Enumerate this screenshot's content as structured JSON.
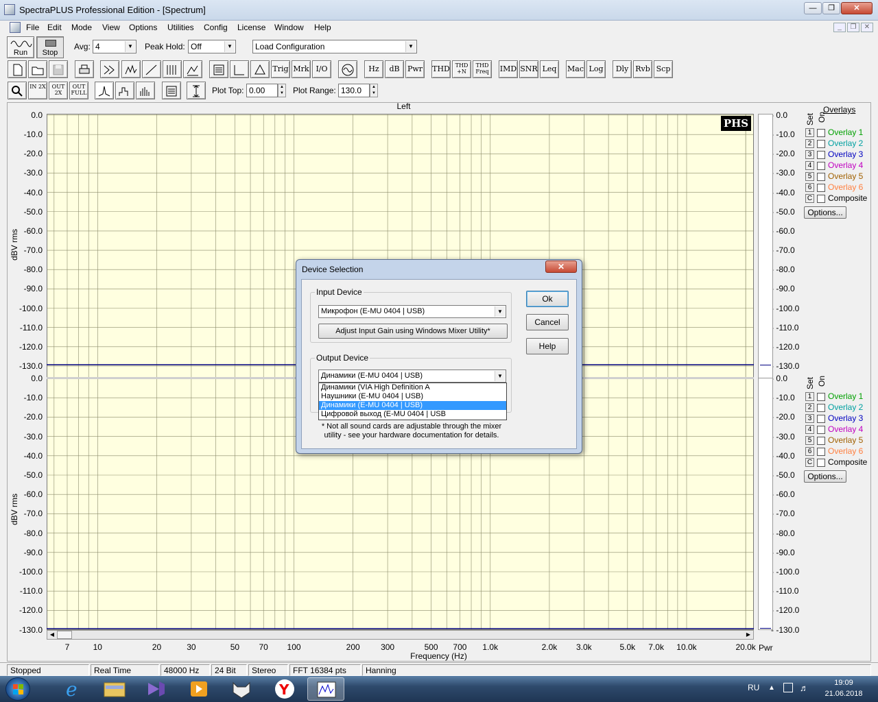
{
  "window": {
    "title": "SpectraPLUS Professional Edition - [Spectrum]"
  },
  "menu": [
    "File",
    "Edit",
    "Mode",
    "View",
    "Options",
    "Utilities",
    "Config",
    "License",
    "Window",
    "Help"
  ],
  "toolbar1": {
    "run": "Run",
    "stop": "Stop",
    "avg_label": "Avg:",
    "avg_value": "4",
    "peak_label": "Peak Hold:",
    "peak_value": "Off",
    "load_config": "Load Configuration"
  },
  "toolbar2": {
    "trig": "Trig",
    "mrk": "Mrk",
    "io": "I/O",
    "hz": "Hz",
    "db": "dB",
    "pwr": "Pwr",
    "thd": "THD",
    "thdn": "THD +N",
    "thdfreq": "THD Freq",
    "imd": "IMD",
    "snr": "SNR",
    "leq": "Leq",
    "mac": "Mac",
    "log": "Log",
    "dly": "Dly",
    "rvb": "Rvb",
    "scp": "Scp"
  },
  "toolbar3": {
    "in2x": "IN 2X",
    "out2x": "OUT 2X",
    "outfull": "OUT FULL",
    "plot_top_label": "Plot Top:",
    "plot_top_value": "0.00",
    "plot_range_label": "Plot Range:",
    "plot_range_value": "130.0"
  },
  "plot": {
    "channel": "Left",
    "logo": "PHS",
    "ylabel": "dBV rms",
    "xlabel": "Frequency (Hz)",
    "y_ticks": [
      "0.0",
      "-10.0",
      "-20.0",
      "-30.0",
      "-40.0",
      "-50.0",
      "-60.0",
      "-70.0",
      "-80.0",
      "-90.0",
      "-100.0",
      "-110.0",
      "-120.0",
      "-130.0"
    ],
    "x_ticks": [
      "7",
      "10",
      "20",
      "30",
      "50",
      "70",
      "100",
      "200",
      "300",
      "500",
      "700",
      "1.0k",
      "2.0k",
      "3.0k",
      "5.0k",
      "7.0k",
      "10.0k",
      "20.0k"
    ],
    "pwr_label": "Pwr",
    "bg_color": "#ffffe0",
    "grid_color": "#8a8a6a",
    "trace_color": "#000080"
  },
  "overlays": {
    "title": "Overlays",
    "set_label": "Set",
    "on_label": "On",
    "items": [
      {
        "num": "1",
        "label": "Overlay 1",
        "color": "#00a000"
      },
      {
        "num": "2",
        "label": "Overlay 2",
        "color": "#00a0a0"
      },
      {
        "num": "3",
        "label": "Overlay 3",
        "color": "#0000c0"
      },
      {
        "num": "4",
        "label": "Overlay 4",
        "color": "#c000c0"
      },
      {
        "num": "5",
        "label": "Overlay 5",
        "color": "#a06000"
      },
      {
        "num": "6",
        "label": "Overlay 6",
        "color": "#ff8040"
      },
      {
        "num": "C",
        "label": "Composite",
        "color": "#000000"
      }
    ],
    "options_button": "Options..."
  },
  "dialog": {
    "title": "Device Selection",
    "input_group": "Input Device",
    "input_value": "Микрофон (E-MU 0404 | USB)",
    "adjust_button": "Adjust Input Gain using Windows Mixer Utility*",
    "output_group": "Output Device",
    "output_value": "Динамики (E-MU 0404 | USB)",
    "output_options": [
      "Динамики (VIA High Definition A",
      "Наушники (E-MU 0404 | USB)",
      "Динамики (E-MU 0404 | USB)",
      "Цифровой выход (E-MU 0404 | USB"
    ],
    "selected_index": 2,
    "note_line1": "* Not all sound cards are adjustable through the mixer",
    "note_line2": "utility - see your hardware documentation for details.",
    "ok": "Ok",
    "cancel": "Cancel",
    "help": "Help"
  },
  "statusbar": [
    "Stopped",
    "Real Time",
    "48000 Hz",
    "24 Bit",
    "Stereo",
    "FFT 16384 pts",
    "Hanning"
  ],
  "taskbar": {
    "lang": "RU",
    "time": "19:09",
    "date": "21.06.2018"
  }
}
